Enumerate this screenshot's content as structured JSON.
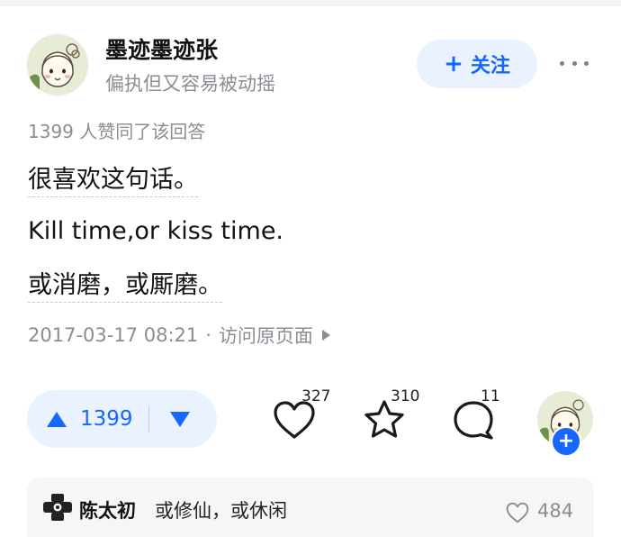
{
  "author": {
    "name": "墨迹墨迹张",
    "bio": "偏执但又容易被动摇"
  },
  "follow_button": {
    "plus": "+",
    "label": "关注"
  },
  "upvote_summary": "1399 人赞同了该回答",
  "content": {
    "line1": "很喜欢这句话。",
    "line2": "Kill time,or kiss time.",
    "line3": "或消磨，或厮磨。"
  },
  "meta": {
    "timestamp": "2017-03-17 08:21",
    "separator": "·",
    "link_label": "访问原页面"
  },
  "vote": {
    "count": "1399"
  },
  "actions": {
    "likes": "327",
    "favorites": "310",
    "comments": "11"
  },
  "follow_small_plus": "+",
  "top_comment": {
    "user": "陈太初",
    "text": "或修仙，或休闲",
    "likes": "484"
  },
  "colors": {
    "accent": "#1766ff",
    "accent_bg": "#eaf2ff",
    "muted_text": "#8a8d93"
  }
}
